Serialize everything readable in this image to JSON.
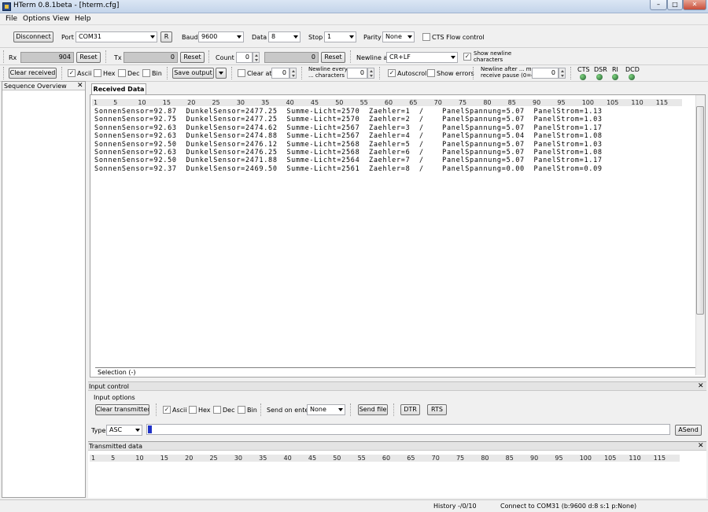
{
  "window": {
    "title": "HTerm 0.8.1beta - [hterm.cfg]"
  },
  "menu": {
    "file": "File",
    "options": "Options",
    "view": "View",
    "help": "Help"
  },
  "connection": {
    "disconnect_label": "Disconnect",
    "port_label": "Port",
    "port_value": "COM31",
    "refresh_label": "R",
    "baud_label": "Baud",
    "baud_value": "9600",
    "data_label": "Data",
    "data_value": "8",
    "stop_label": "Stop",
    "stop_value": "1",
    "parity_label": "Parity",
    "parity_value": "None",
    "cts_label": "CTS Flow control"
  },
  "counters": {
    "rx_label": "Rx",
    "rx_value": "904",
    "rx_reset": "Reset",
    "tx_label": "Tx",
    "tx_value": "0",
    "tx_reset": "Reset",
    "count_label": "Count",
    "count_value": "0",
    "count_field_value": "0",
    "count_reset": "Reset",
    "newline_label": "Newline at",
    "newline_value": "CR+LF",
    "show_newline_label1": "Show newline",
    "show_newline_label2": "characters",
    "show_newline_check": "✓"
  },
  "receive_options": {
    "clear_received": "Clear received",
    "ascii": "Ascii",
    "ascii_check": "✓",
    "hex": "Hex",
    "dec": "Dec",
    "bin": "Bin",
    "save_output": "Save output",
    "clear_at_label": "Clear at",
    "clear_at_value": "0",
    "newline_every1": "Newline every",
    "newline_every2": "... characters",
    "newline_every_value": "0",
    "autoscroll": "Autoscroll",
    "autoscroll_check": "✓",
    "show_errors": "Show errors",
    "newline_after1": "Newline after ... ms",
    "newline_after2": "receive pause (0=off)",
    "newline_after_value": "0",
    "cts": "CTS",
    "dsr": "DSR",
    "ri": "RI",
    "dcd": "DCD",
    "led_color": "#2c8a3d"
  },
  "sequence_panel": {
    "title": "Sequence Overview",
    "close": "✕"
  },
  "received": {
    "tab": "Received Data",
    "ruler": [
      "1",
      "5",
      "10",
      "15",
      "20",
      "25",
      "30",
      "35",
      "40",
      "45",
      "50",
      "55",
      "60",
      "65",
      "70",
      "75",
      "80",
      "85",
      "90",
      "95",
      "100",
      "105",
      "110",
      "115"
    ],
    "lines": [
      "SonnenSensor=92.87  DunkelSensor=2477.25  Summe-Licht=2570  Zaehler=1  /    PanelSpannung=5.07  PanelStrom=1.13",
      "SonnenSensor=92.75  DunkelSensor=2477.25  Summe-Licht=2570  Zaehler=2  /    PanelSpannung=5.07  PanelStrom=1.03",
      "SonnenSensor=92.63  DunkelSensor=2474.62  Summe-Licht=2567  Zaehler=3  /    PanelSpannung=5.07  PanelStrom=1.17",
      "SonnenSensor=92.63  DunkelSensor=2474.88  Summe-Licht=2567  Zaehler=4  /    PanelSpannung=5.04  PanelStrom=1.08",
      "SonnenSensor=92.50  DunkelSensor=2476.12  Summe-Licht=2568  Zaehler=5  /    PanelSpannung=5.07  PanelStrom=1.03",
      "SonnenSensor=92.63  DunkelSensor=2476.25  Summe-Licht=2568  Zaehler=6  /    PanelSpannung=5.07  PanelStrom=1.08",
      "SonnenSensor=92.50  DunkelSensor=2471.88  Summe-Licht=2564  Zaehler=7  /    PanelSpannung=5.07  PanelStrom=1.17",
      "SonnenSensor=92.37  DunkelSensor=2469.50  Summe-Licht=2561  Zaehler=8  /    PanelSpannung=0.00  PanelStrom=0.09"
    ],
    "selection": "Selection (-)"
  },
  "input_control": {
    "title": "Input control",
    "close": "✕",
    "options_label": "Input options",
    "clear_transmitted": "Clear transmitted",
    "ascii": "Ascii",
    "ascii_check": "✓",
    "hex": "Hex",
    "dec": "Dec",
    "bin": "Bin",
    "send_on_enter_label": "Send on enter",
    "send_on_enter_value": "None",
    "send_file": "Send file",
    "dtr": "DTR",
    "rts": "RTS",
    "type_label": "Type",
    "type_value": "ASC",
    "asend": "ASend"
  },
  "transmitted": {
    "title": "Transmitted data",
    "close": "✕",
    "ruler": [
      "1",
      "5",
      "10",
      "15",
      "20",
      "25",
      "30",
      "35",
      "40",
      "45",
      "50",
      "55",
      "60",
      "65",
      "70",
      "75",
      "80",
      "85",
      "90",
      "95",
      "100",
      "105",
      "110",
      "115"
    ]
  },
  "status": {
    "history": "History -/0/10",
    "connection": "Connect to COM31 (b:9600 d:8 s:1 p:None)"
  }
}
